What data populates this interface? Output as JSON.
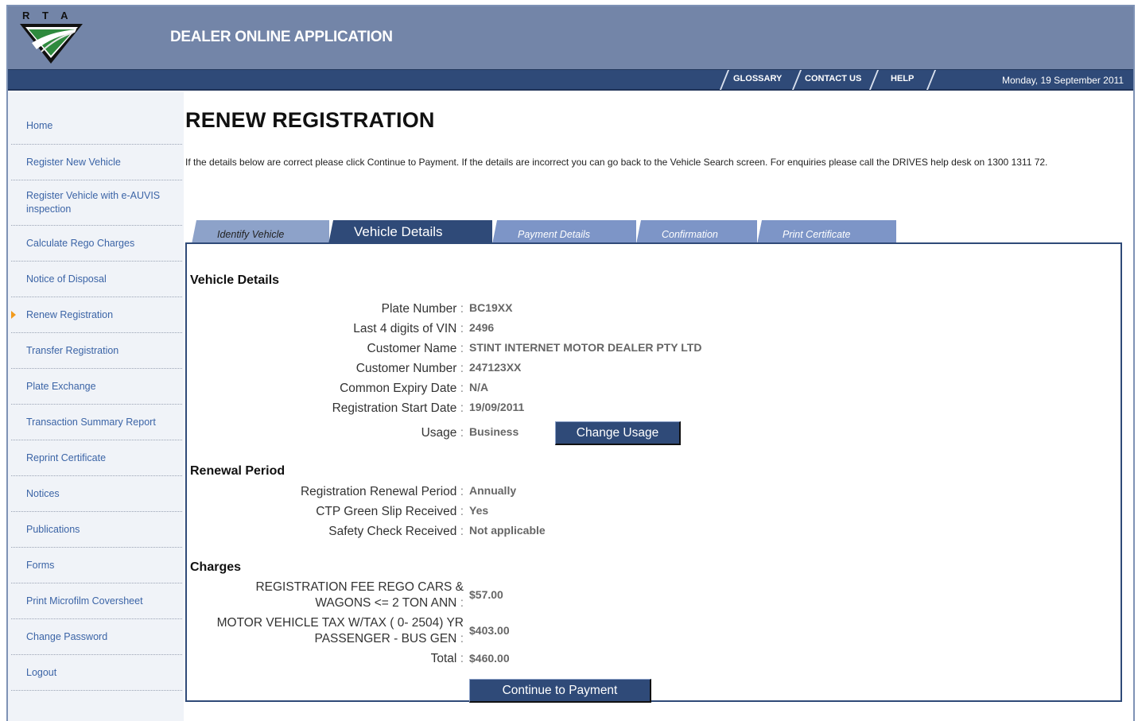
{
  "header": {
    "logo_text": "R T A",
    "app_title": "DEALER ONLINE APPLICATION"
  },
  "navbar": {
    "links": [
      "GLOSSARY",
      "CONTACT US",
      "HELP"
    ],
    "date": "Monday, 19 September 2011"
  },
  "sidebar": {
    "items": [
      {
        "label": "Home"
      },
      {
        "label": "Register New Vehicle"
      },
      {
        "label": "Register Vehicle with e-AUVIS inspection"
      },
      {
        "label": "Calculate Rego Charges"
      },
      {
        "label": "Notice of Disposal"
      },
      {
        "label": "Renew Registration",
        "active": true
      },
      {
        "label": "Transfer Registration"
      },
      {
        "label": "Plate Exchange"
      },
      {
        "label": "Transaction Summary Report"
      },
      {
        "label": "Reprint Certificate"
      },
      {
        "label": "Notices"
      },
      {
        "label": "Publications"
      },
      {
        "label": "Forms"
      },
      {
        "label": "Print Microfilm Coversheet"
      },
      {
        "label": "Change Password"
      },
      {
        "label": "Logout"
      }
    ],
    "active_marker_color": "#f29b1d"
  },
  "main": {
    "title": "RENEW REGISTRATION",
    "intro": "If the details below are correct please click Continue to Payment. If the details are incorrect you can go back to the Vehicle Search screen. For enquiries please call the DRIVES help desk on 1300 1311 72.",
    "tabs": [
      {
        "label": "Identify Vehicle"
      },
      {
        "label": "Vehicle Details",
        "active": true
      },
      {
        "label": "Payment Details"
      },
      {
        "label": "Confirmation"
      },
      {
        "label": "Print Certificate"
      }
    ],
    "vehicle_details": {
      "title": "Vehicle Details",
      "rows": [
        {
          "label": "Plate Number",
          "value": "BC19XX"
        },
        {
          "label": "Last 4 digits of VIN",
          "value": "2496"
        },
        {
          "label": "Customer Name",
          "value": "STINT INTERNET MOTOR DEALER PTY LTD"
        },
        {
          "label": "Customer Number",
          "value": "247123XX"
        },
        {
          "label": "Common Expiry Date",
          "value": "N/A"
        },
        {
          "label": "Registration Start Date",
          "value": "19/09/2011"
        },
        {
          "label": "Usage",
          "value": "Business"
        }
      ],
      "change_usage_button": "Change Usage"
    },
    "renewal_period": {
      "title": "Renewal Period",
      "rows": [
        {
          "label": "Registration Renewal Period",
          "value": "Annually"
        },
        {
          "label": "CTP Green Slip Received",
          "value": "Yes"
        },
        {
          "label": "Safety Check Received",
          "value": "Not applicable"
        }
      ]
    },
    "charges": {
      "title": "Charges",
      "rows": [
        {
          "label_line1": "REGISTRATION FEE REGO CARS &",
          "label_line2": "WAGONS <= 2 TON ANN",
          "value": "$57.00"
        },
        {
          "label_line1": "MOTOR VEHICLE TAX W/TAX ( 0- 2504) YR",
          "label_line2": "PASSENGER - BUS GEN",
          "value": "$403.00"
        }
      ],
      "total": {
        "label": "Total",
        "value": "$460.00"
      }
    },
    "continue_button": "Continue to Payment"
  },
  "colors": {
    "header_bg": "#7385a8",
    "navbar_bg": "#2f4a78",
    "link": "#3b64a6",
    "tab_inactive": "#7d95c7",
    "tab_active": "#2f4a78"
  }
}
